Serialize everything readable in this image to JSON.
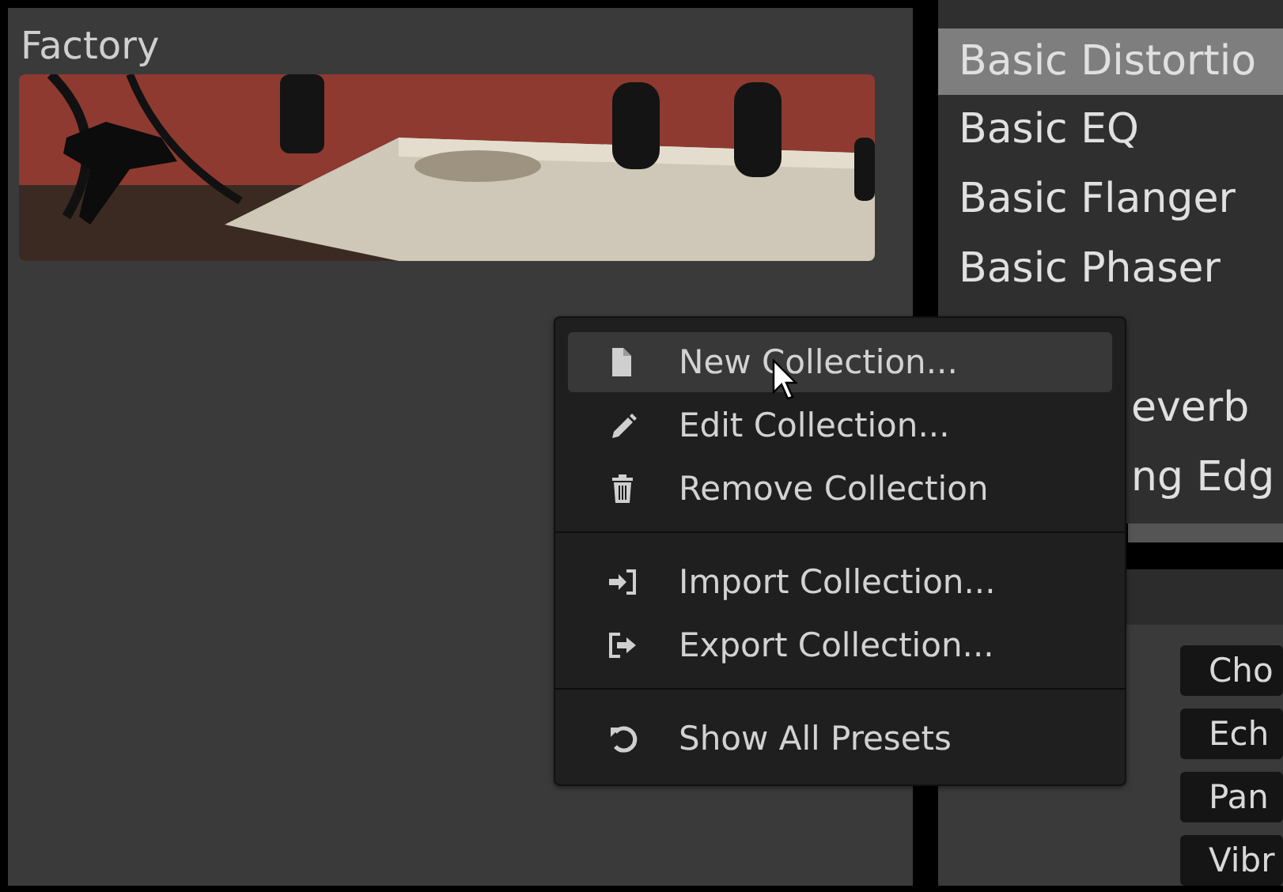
{
  "collection_panel": {
    "title": "Factory"
  },
  "preset_list": {
    "items": [
      {
        "label": "Basic Distortio",
        "selected": true,
        "kind": "full"
      },
      {
        "label": "Basic EQ",
        "selected": false,
        "kind": "full"
      },
      {
        "label": "Basic Flanger",
        "selected": false,
        "kind": "full"
      },
      {
        "label": "Basic Phaser",
        "selected": false,
        "kind": "full"
      },
      {
        "label": "everb",
        "selected": false,
        "kind": "partial"
      },
      {
        "label": "ng Edg",
        "selected": false,
        "kind": "partial"
      }
    ]
  },
  "effect_tags": [
    "Cho",
    "Ech",
    "Pan",
    "Vibr"
  ],
  "context_menu": {
    "groups": [
      [
        {
          "label": "New Collection...",
          "highlighted": true
        },
        {
          "label": "Edit Collection...",
          "highlighted": false
        },
        {
          "label": "Remove Collection",
          "highlighted": false
        }
      ],
      [
        {
          "label": "Import Collection...",
          "highlighted": false
        },
        {
          "label": "Export Collection...",
          "highlighted": false
        }
      ],
      [
        {
          "label": "Show All Presets",
          "highlighted": false
        }
      ]
    ]
  }
}
